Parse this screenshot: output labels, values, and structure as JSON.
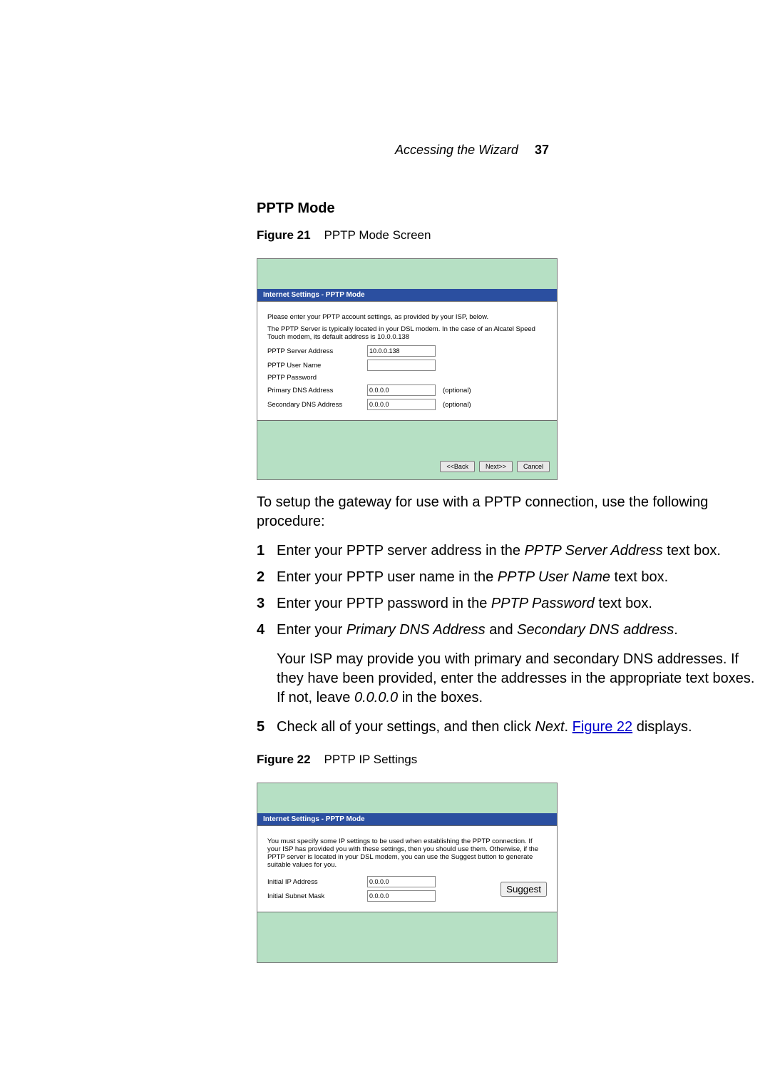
{
  "header": {
    "section": "Accessing the Wizard",
    "page_number": "37"
  },
  "section_title": "PPTP Mode",
  "figure21": {
    "caption_label": "Figure 21",
    "caption_text": "PPTP Mode Screen",
    "window_title": "Internet Settings - PPTP Mode",
    "intro1": "Please enter your PPTP account settings, as provided by your ISP, below.",
    "intro2": "The PPTP Server is typically located in your DSL modem. In the case of an Alcatel Speed Touch modem, its default address is 10.0.0.138",
    "fields": {
      "server_label": "PPTP Server Address",
      "server_value": "10.0.0.138",
      "user_label": "PPTP User Name",
      "user_value": "",
      "password_label": "PPTP Password",
      "pdns_label": "Primary DNS Address",
      "pdns_value": "0.0.0.0",
      "pdns_hint": "(optional)",
      "sdns_label": "Secondary DNS Address",
      "sdns_value": "0.0.0.0",
      "sdns_hint": "(optional)"
    },
    "buttons": {
      "back": "<<Back",
      "next": "Next>>",
      "cancel": "Cancel"
    }
  },
  "body_after_fig21": "To setup the gateway for use with a PPTP connection, use the following procedure:",
  "steps": {
    "s1a": "Enter your PPTP server address in the ",
    "s1b": "PPTP Server Address",
    "s1c": " text box.",
    "s2a": "Enter your PPTP user name in the ",
    "s2b": "PPTP User Name",
    "s2c": " text box.",
    "s3a": "Enter your PPTP password in the ",
    "s3b": "PPTP Password",
    "s3c": " text box.",
    "s4a": "Enter your ",
    "s4b": "Primary DNS Address",
    "s4c": " and ",
    "s4d": "Secondary DNS address",
    "s4e": ".",
    "s4_para_a": "Your ISP may provide you with primary and secondary DNS addresses. If they have been provided, enter the addresses in the appropriate text boxes. If not, leave ",
    "s4_para_b": "0.0.0.0",
    "s4_para_c": " in the boxes.",
    "s5a": "Check all of your settings, and then click ",
    "s5b": "Next",
    "s5c": ". ",
    "s5_link": "Figure 22",
    "s5d": " displays."
  },
  "figure22": {
    "caption_label": "Figure 22",
    "caption_text": "PPTP IP Settings",
    "window_title": "Internet Settings - PPTP Mode",
    "intro": "You must specify some IP settings to be used when establishing the PPTP connection. If your ISP has provided you with these settings, then you should use them. Otherwise, if the PPTP server is located in your DSL modem, you can use the Suggest button to generate suitable values for you.",
    "fields": {
      "ip_label": "Initial IP Address",
      "ip_value": "0.0.0.0",
      "mask_label": "Initial Subnet Mask",
      "mask_value": "0.0.0.0"
    },
    "buttons": {
      "suggest": "Suggest"
    }
  }
}
